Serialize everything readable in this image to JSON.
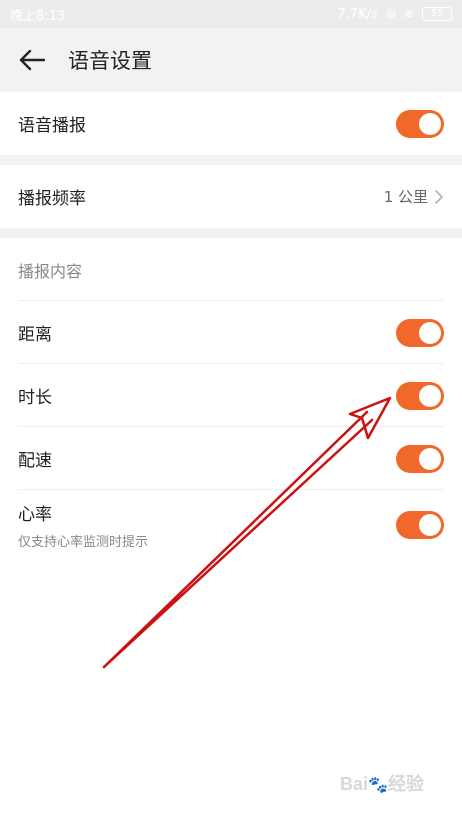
{
  "status_bar": {
    "time": "晚上8:13",
    "network_speed": "7.7K/s",
    "signal": "ılıl",
    "wifi": "≋",
    "battery": "59"
  },
  "header": {
    "back_icon": "arrow-left-icon",
    "title": "语音设置"
  },
  "voice_broadcast": {
    "label": "语音播报",
    "enabled": true
  },
  "frequency": {
    "label": "播报频率",
    "value": "1 公里",
    "chevron_icon": "chevron-right-icon"
  },
  "content": {
    "header": "播报内容",
    "items": [
      {
        "label": "距离",
        "enabled": true
      },
      {
        "label": "时长",
        "enabled": true
      },
      {
        "label": "配速",
        "enabled": true
      },
      {
        "label": "心率",
        "sublabel": "仅支持心率监测时提示",
        "enabled": true
      }
    ]
  },
  "toggle_color": "#f0692b",
  "annotation_color": "#cc1111",
  "watermark": {
    "text": "Bai",
    "paw": "🐾",
    "suffix": "经验"
  }
}
